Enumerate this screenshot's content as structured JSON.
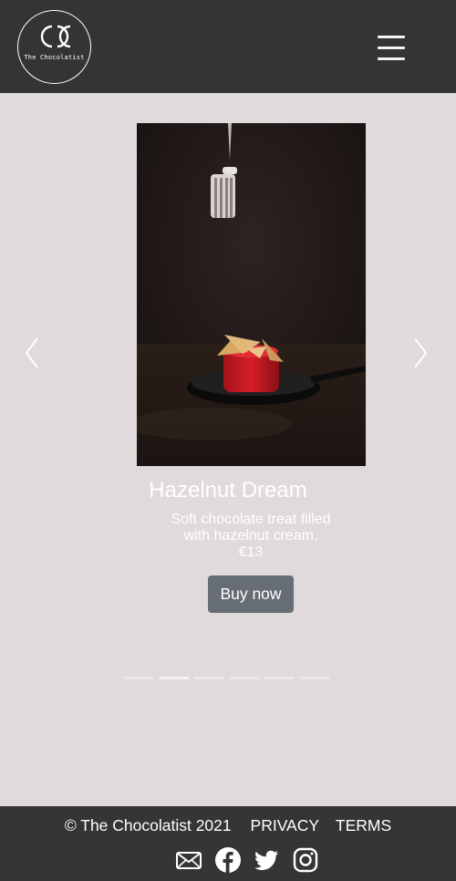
{
  "navbar": {
    "logo_text": "The Chocolatist"
  },
  "carousel": {
    "active_index": 1,
    "slide_count": 6,
    "slide": {
      "title": "Hazelnut Dream",
      "description": "Soft chocolate treat filled with hazelnut cream.",
      "price": "€13",
      "button_label": "Buy now"
    }
  },
  "footer": {
    "copyright": "© The Chocolatist 2021",
    "links": [
      "PRIVACY",
      "TERMS"
    ],
    "social_icons": [
      "mail-icon",
      "facebook-icon",
      "twitter-icon",
      "instagram-icon"
    ]
  },
  "colors": {
    "nav_bg": "#343434",
    "page_bg": "#e0dadd",
    "button_bg": "#676d75",
    "footer_bg": "#353535"
  }
}
